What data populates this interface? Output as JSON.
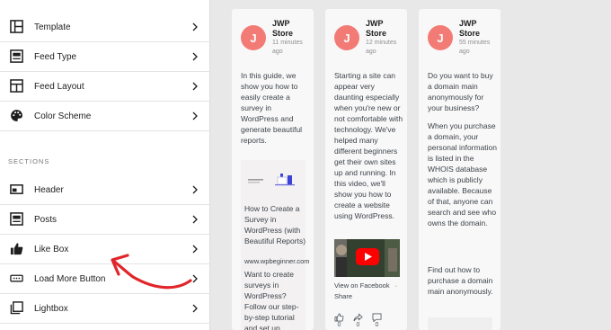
{
  "sidebar": {
    "items": [
      {
        "label": "Template",
        "icon": "template-icon"
      },
      {
        "label": "Feed Type",
        "icon": "feed-type-icon"
      },
      {
        "label": "Feed Layout",
        "icon": "feed-layout-icon"
      },
      {
        "label": "Color Scheme",
        "icon": "palette-icon"
      }
    ],
    "sections_heading": "SECTIONS",
    "sections": [
      {
        "label": "Header",
        "icon": "header-icon"
      },
      {
        "label": "Posts",
        "icon": "posts-icon"
      },
      {
        "label": "Like Box",
        "icon": "thumbs-up-icon"
      },
      {
        "label": "Load More Button",
        "icon": "load-more-icon"
      },
      {
        "label": "Lightbox",
        "icon": "lightbox-icon"
      }
    ]
  },
  "feed": {
    "accent_color": "#f27b75",
    "cards": [
      {
        "avatar_letter": "J",
        "author": "JWP Store",
        "time": "11 minutes ago",
        "text": "In this guide, we show you how to easily create a survey in WordPress and generate beautiful reports.",
        "link_title": "How to Create a Survey in WordPress (with Beautiful Reports)",
        "domain": "www.wpbeginner.com",
        "link_desc": "Want to create surveys in WordPress? Follow our step-by-step tutorial and set up surveys and"
      },
      {
        "avatar_letter": "J",
        "author": "JWP Store",
        "time": "12 minutes ago",
        "text": "Starting a site can appear very daunting especially when you're new or not comfortable with technology. We've helped many different beginners get their own sites up and running. In this video, we'll show you how to create a website using WordPress.",
        "fb_link": "View on Facebook",
        "fb_sep": "·",
        "share": "Share",
        "reactions": [
          {
            "icon": "like-icon",
            "count": "0"
          },
          {
            "icon": "share-arrow-icon",
            "count": "0"
          },
          {
            "icon": "comment-icon",
            "count": "0"
          }
        ]
      },
      {
        "avatar_letter": "J",
        "author": "JWP Store",
        "time": "55 minutes ago",
        "text_1": "Do you want to buy a domain main anonymously for your business?",
        "text_2": "When you purchase a domain, your personal information is listed in the WHOIS database which is publicly available. Because of that, anyone can search and see who owns the domain.",
        "text_3": "Find out how to purchase a domain main anonymously."
      }
    ]
  }
}
